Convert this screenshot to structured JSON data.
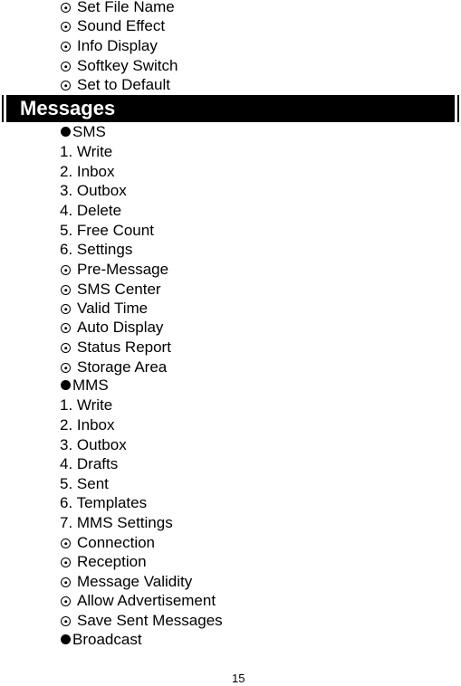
{
  "top_items": [
    {
      "icon": "radio-dot-icon",
      "label": "Set File Name"
    },
    {
      "icon": "radio-dot-icon",
      "label": "Sound Effect"
    },
    {
      "icon": "radio-dot-icon",
      "label": "Info Display"
    },
    {
      "icon": "radio-dot-icon",
      "label": "Softkey Switch"
    },
    {
      "icon": "radio-dot-icon",
      "label": "Set to Default"
    }
  ],
  "section": {
    "title": "Messages",
    "bar_color": "#000000",
    "text_color": "#ffffff"
  },
  "sms": {
    "heading": "SMS",
    "items": [
      "1. Write",
      "2. Inbox",
      "3. Outbox",
      "4. Delete",
      "5. Free Count",
      "6. Settings"
    ],
    "settings": [
      "Pre-Message",
      "SMS Center",
      "Valid Time",
      "Auto Display",
      "Status Report",
      "Storage Area"
    ]
  },
  "mms": {
    "heading": "MMS",
    "items": [
      "1. Write",
      "2. Inbox",
      "3. Outbox",
      "4. Drafts",
      "5. Sent",
      "6. Templates",
      "7. MMS Settings"
    ],
    "settings": [
      "Connection",
      "Reception",
      "Message Validity",
      "Allow Advertisement",
      "Save Sent Messages"
    ]
  },
  "broadcast": {
    "heading": "Broadcast"
  },
  "page_number": "15"
}
